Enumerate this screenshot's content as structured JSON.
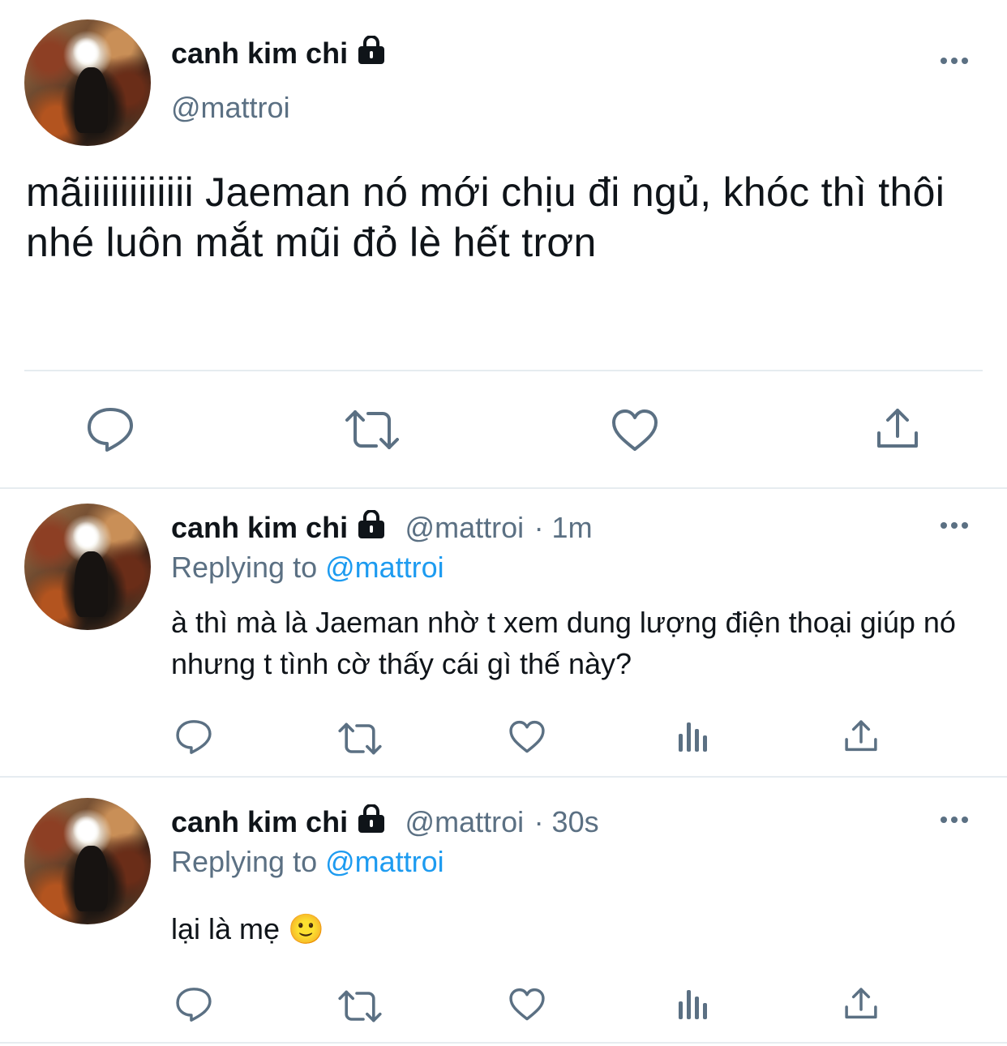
{
  "main_tweet": {
    "display_name": "canh kim chi",
    "handle": "@mattroi",
    "text": "mãiiiiiiiiiiii Jaeman nó mới chịu đi ngủ, khóc thì thôi nhé luôn mắt mũi đỏ lè hết trơn",
    "actions": [
      "reply-icon",
      "retweet-icon",
      "like-icon",
      "share-icon"
    ]
  },
  "replies": [
    {
      "display_name": "canh kim chi",
      "handle": "@mattroi",
      "time": "· 1m",
      "replying_prefix": "Replying to ",
      "replying_to": "@mattroi",
      "text": "à thì mà là Jaeman nhờ t xem dung lượng điện thoại giúp nó nhưng t tình cờ thấy cái gì thế này?"
    },
    {
      "display_name": "canh kim chi",
      "handle": "@mattroi",
      "time": "· 30s",
      "replying_prefix": "Replying to ",
      "replying_to": "@mattroi",
      "text": "lại là mẹ 🙂"
    }
  ],
  "colors": {
    "primary_text": "#0f1419",
    "secondary_text": "#5b7083",
    "link": "#1d9bf0",
    "divider": "#e6ecf0"
  }
}
